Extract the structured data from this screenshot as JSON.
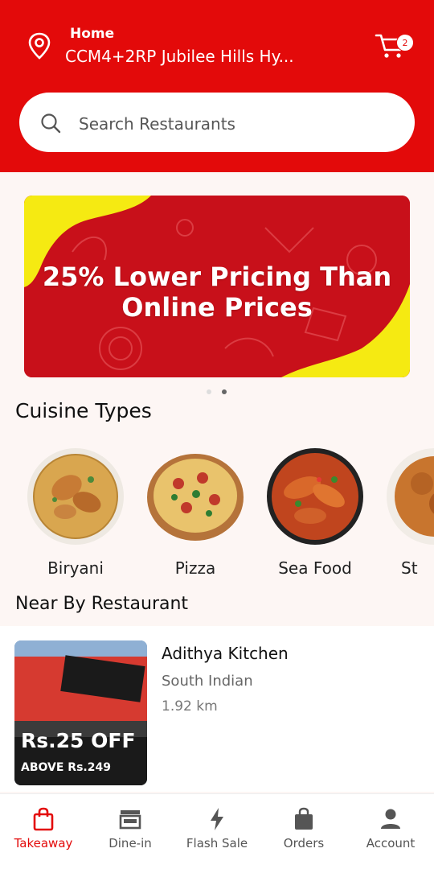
{
  "header": {
    "location_title": "Home",
    "location_address": "CCM4+2RP Jubilee Hills Hy...",
    "cart_count": "2"
  },
  "search": {
    "placeholder": "Search Restaurants"
  },
  "banner": {
    "line1": "25% Lower Pricing Than",
    "line2": "Online Prices",
    "slide_count": 2,
    "active_slide": 2
  },
  "cuisine": {
    "title": "Cuisine Types",
    "items": [
      {
        "label": "Biryani"
      },
      {
        "label": "Pizza"
      },
      {
        "label": "Sea Food"
      },
      {
        "label": "St"
      }
    ]
  },
  "nearby": {
    "title": "Near By Restaurant",
    "restaurants": [
      {
        "name": "Adithya Kitchen",
        "cuisine": "South Indian",
        "distance": "1.92 km",
        "offer": "Rs.25 OFF",
        "offer_condition": "ABOVE Rs.249"
      }
    ]
  },
  "nav": {
    "items": [
      {
        "label": "Takeaway"
      },
      {
        "label": "Dine-in"
      },
      {
        "label": "Flash Sale"
      },
      {
        "label": "Orders"
      },
      {
        "label": "Account"
      }
    ],
    "active": "Takeaway"
  },
  "colors": {
    "brand": "#e30a0a",
    "banner_accent": "#f5ea12"
  }
}
